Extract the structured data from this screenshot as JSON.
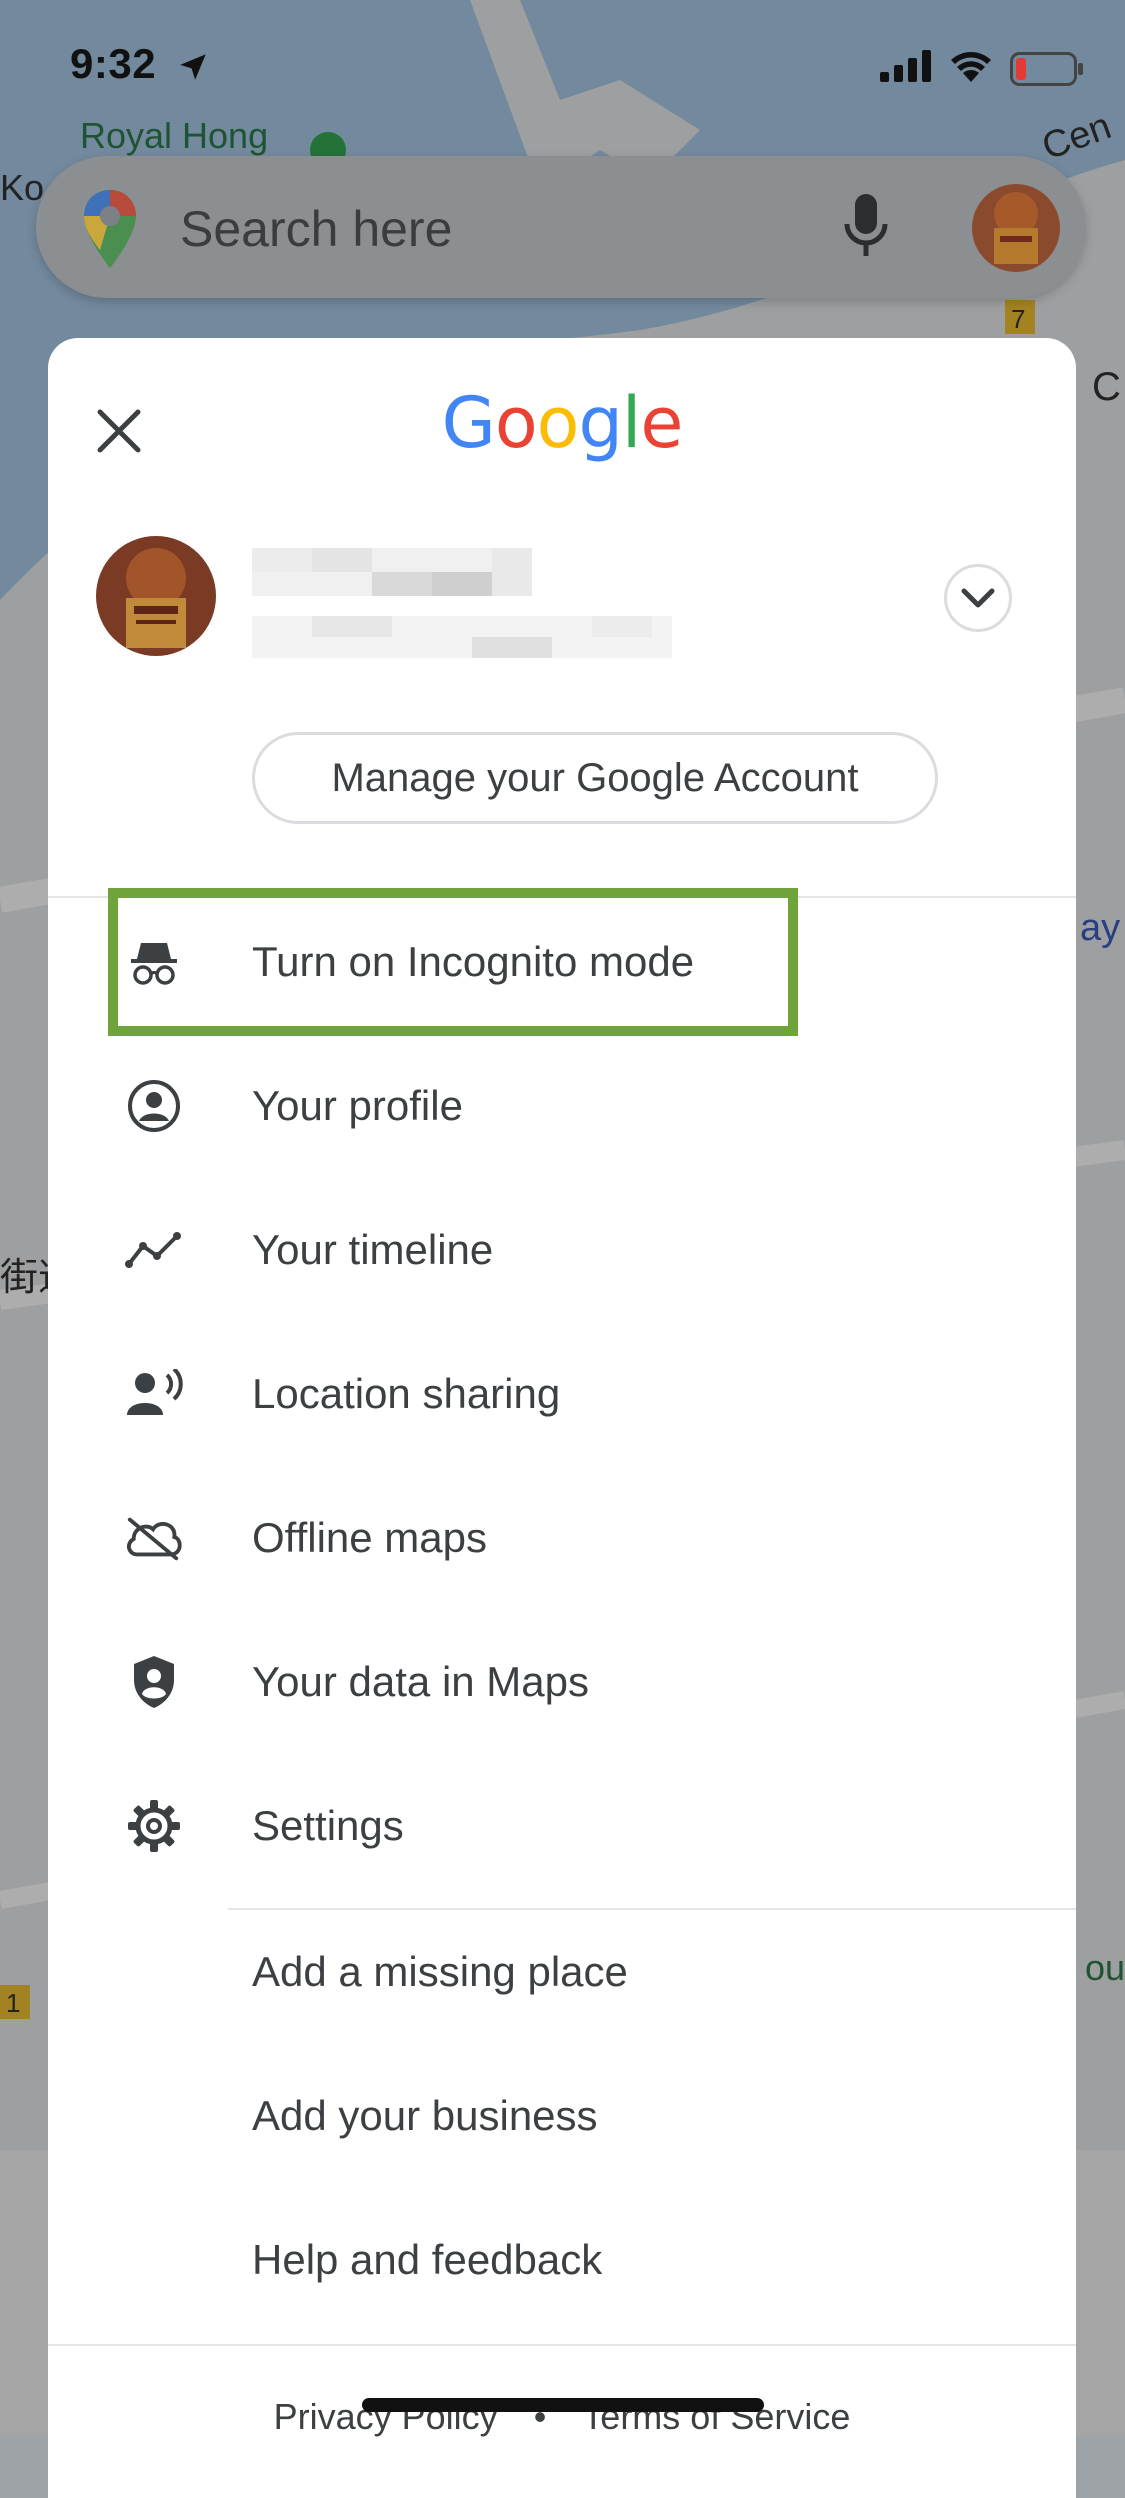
{
  "status_bar": {
    "time": "9:32"
  },
  "map": {
    "labels": [
      "Royal Hong",
      "Cen",
      "Ko",
      "C",
      "ay",
      "街道",
      "out",
      "7",
      "1"
    ]
  },
  "search": {
    "placeholder": "Search here"
  },
  "sheet": {
    "logo_letters": [
      {
        "char": "G",
        "color": "#4285F4"
      },
      {
        "char": "o",
        "color": "#EA4335"
      },
      {
        "char": "o",
        "color": "#FBBC05"
      },
      {
        "char": "g",
        "color": "#4285F4"
      },
      {
        "char": "l",
        "color": "#34A853"
      },
      {
        "char": "e",
        "color": "#EA4335"
      }
    ],
    "manage_account_label": "Manage your Google Account",
    "menu": [
      {
        "label": "Turn on Incognito mode",
        "icon": "incognito-icon"
      },
      {
        "label": "Your profile",
        "icon": "profile-icon"
      },
      {
        "label": "Your timeline",
        "icon": "timeline-icon"
      },
      {
        "label": "Location sharing",
        "icon": "location-sharing-icon"
      },
      {
        "label": "Offline maps",
        "icon": "offline-maps-icon"
      },
      {
        "label": "Your data in Maps",
        "icon": "data-shield-icon"
      },
      {
        "label": "Settings",
        "icon": "gear-icon"
      }
    ],
    "secondary_menu": [
      {
        "label": "Add a missing place"
      },
      {
        "label": "Add your business"
      },
      {
        "label": "Help and feedback"
      }
    ],
    "footer": {
      "privacy": "Privacy Policy",
      "separator": "•",
      "terms": "Terms of Service"
    }
  },
  "colors": {
    "highlight": "#6fa43a",
    "text": "#3c4043"
  }
}
